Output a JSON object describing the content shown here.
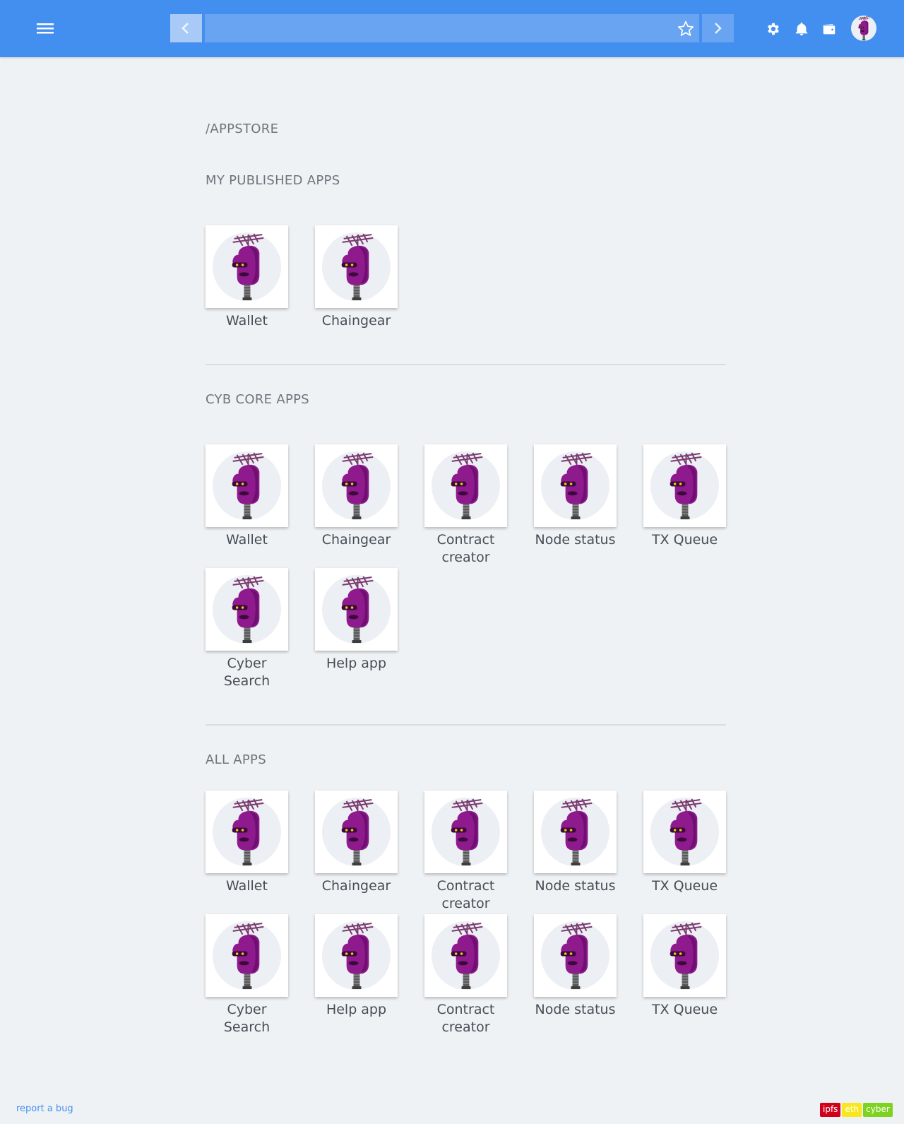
{
  "header": {
    "address_value": "",
    "address_placeholder": "",
    "colors": {
      "bar": "#438ff0",
      "back": "#a9c9f7",
      "address": "#69a4f2"
    },
    "icons": [
      "menu-icon",
      "chevron-left-icon",
      "star-icon",
      "chevron-right-icon",
      "gear-icon",
      "bell-icon",
      "wallet-icon",
      "avatar"
    ]
  },
  "page": {
    "title": "/APPSTORE"
  },
  "sections": {
    "my_published": {
      "title": "MY PUBLISHED APPS",
      "apps": [
        "Wallet",
        "Chaingear"
      ]
    },
    "core": {
      "title": "CYB CORE APPS",
      "apps": [
        "Wallet",
        "Chaingear",
        "Contract creator",
        "Node status",
        "TX Queue",
        "Cyber Search",
        "Help app"
      ]
    },
    "all": {
      "title": "ALL APPS",
      "apps": [
        "Wallet",
        "Chaingear",
        "Contract creator",
        "Node status",
        "TX Queue",
        "Cyber Search",
        "Help app",
        "Contract creator",
        "Node status",
        "TX Queue"
      ]
    }
  },
  "footer": {
    "report_link": "report a bug",
    "badges": [
      {
        "label": "ipfs",
        "color": "#d0021b"
      },
      {
        "label": "eth",
        "color": "#f8e71c"
      },
      {
        "label": "cyber",
        "color": "#7ed321"
      }
    ]
  }
}
